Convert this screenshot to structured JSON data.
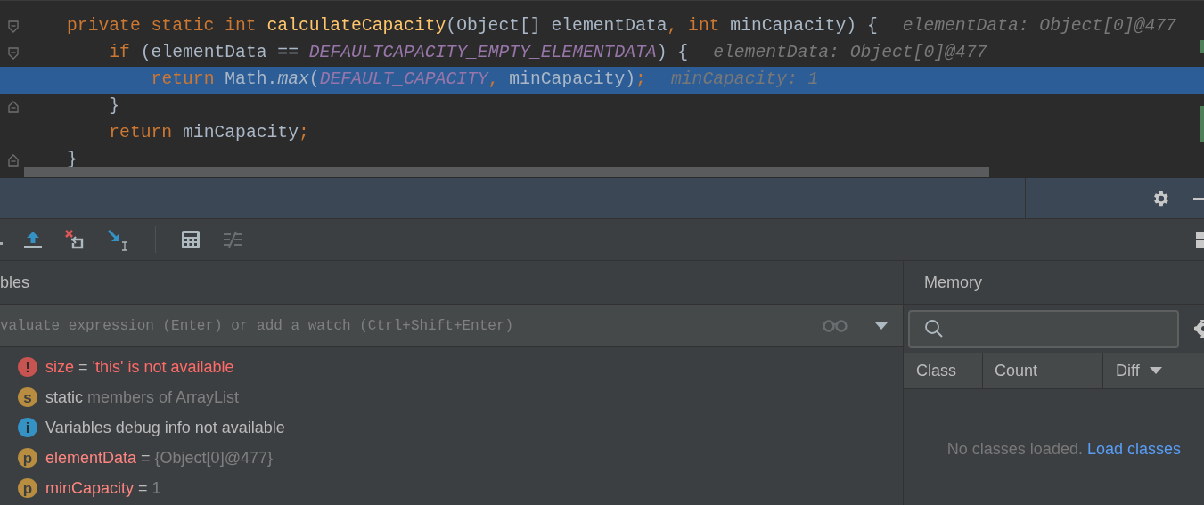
{
  "editor": {
    "lines": [
      {
        "kind": "fold_start",
        "selected": false,
        "tokens": [
          {
            "kind": "keyword",
            "text": "private static int "
          },
          {
            "kind": "function",
            "text": "calculateCapacity"
          },
          {
            "kind": "plain",
            "text": "(Object[] elementData"
          },
          {
            "kind": "keyword",
            "text": ", int "
          },
          {
            "kind": "plain",
            "text": "minCapacity) {"
          }
        ],
        "hint": "elementData: Object[0]@477",
        "children": [
          {
            "kind": "fold_start",
            "selected": false,
            "tokens": [
              {
                "kind": "keyword",
                "text": "if "
              },
              {
                "kind": "plain",
                "text": "(elementData == "
              },
              {
                "kind": "constant",
                "text": "DEFAULTCAPACITY_EMPTY_ELEMENTDATA"
              },
              {
                "kind": "plain",
                "text": ") {"
              }
            ],
            "hint": "elementData: Object[0]@477",
            "children": [
              {
                "selected": true,
                "tokens": [
                  {
                    "kind": "keyword",
                    "text": "return "
                  },
                  {
                    "kind": "plain",
                    "text": "Math."
                  },
                  {
                    "kind": "method",
                    "text": "max"
                  },
                  {
                    "kind": "plain",
                    "text": "("
                  },
                  {
                    "kind": "constant",
                    "text": "DEFAULT_CAPACITY"
                  },
                  {
                    "kind": "keyword",
                    "text": ", "
                  },
                  {
                    "kind": "plain",
                    "text": "minCapacity)"
                  },
                  {
                    "kind": "keyword",
                    "text": ";"
                  }
                ],
                "hint": "minCapacity: 1"
              }
            ]
          },
          {
            "kind": "fold_end",
            "selected": false,
            "tokens": [
              {
                "kind": "plain",
                "text": "}"
              }
            ]
          },
          {
            "selected": false,
            "tokens": [
              {
                "kind": "keyword",
                "text": "return "
              },
              {
                "kind": "plain",
                "text": "minCapacity"
              },
              {
                "kind": "keyword",
                "text": ";"
              }
            ]
          }
        ]
      },
      {
        "kind": "fold_end",
        "selected": false,
        "tokens": [
          {
            "kind": "plain",
            "text": "}"
          }
        ]
      }
    ]
  },
  "variables": {
    "title": "bles",
    "watch_placeholder": "valuate expression (Enter) or add a watch (Ctrl+Shift+Enter)",
    "items": [
      {
        "kind": "error",
        "badge": "!",
        "name": "size",
        "separator": "=",
        "value": "'this' is not available"
      },
      {
        "kind": "static",
        "badge": "s",
        "name": "static",
        "value": "members of ArrayList"
      },
      {
        "kind": "info",
        "badge": "i",
        "name": "Variables debug info not available"
      },
      {
        "kind": "param",
        "badge": "p",
        "name": "elementData",
        "separator": "=",
        "value": "{Object[0]@477}"
      },
      {
        "kind": "param",
        "badge": "p",
        "name": "minCapacity",
        "separator": "=",
        "value": "1"
      }
    ]
  },
  "memory": {
    "title": "Memory",
    "columns": [
      "Class",
      "Count",
      "Diff"
    ],
    "empty_message": "No classes loaded.",
    "load_link": "Load classes"
  }
}
